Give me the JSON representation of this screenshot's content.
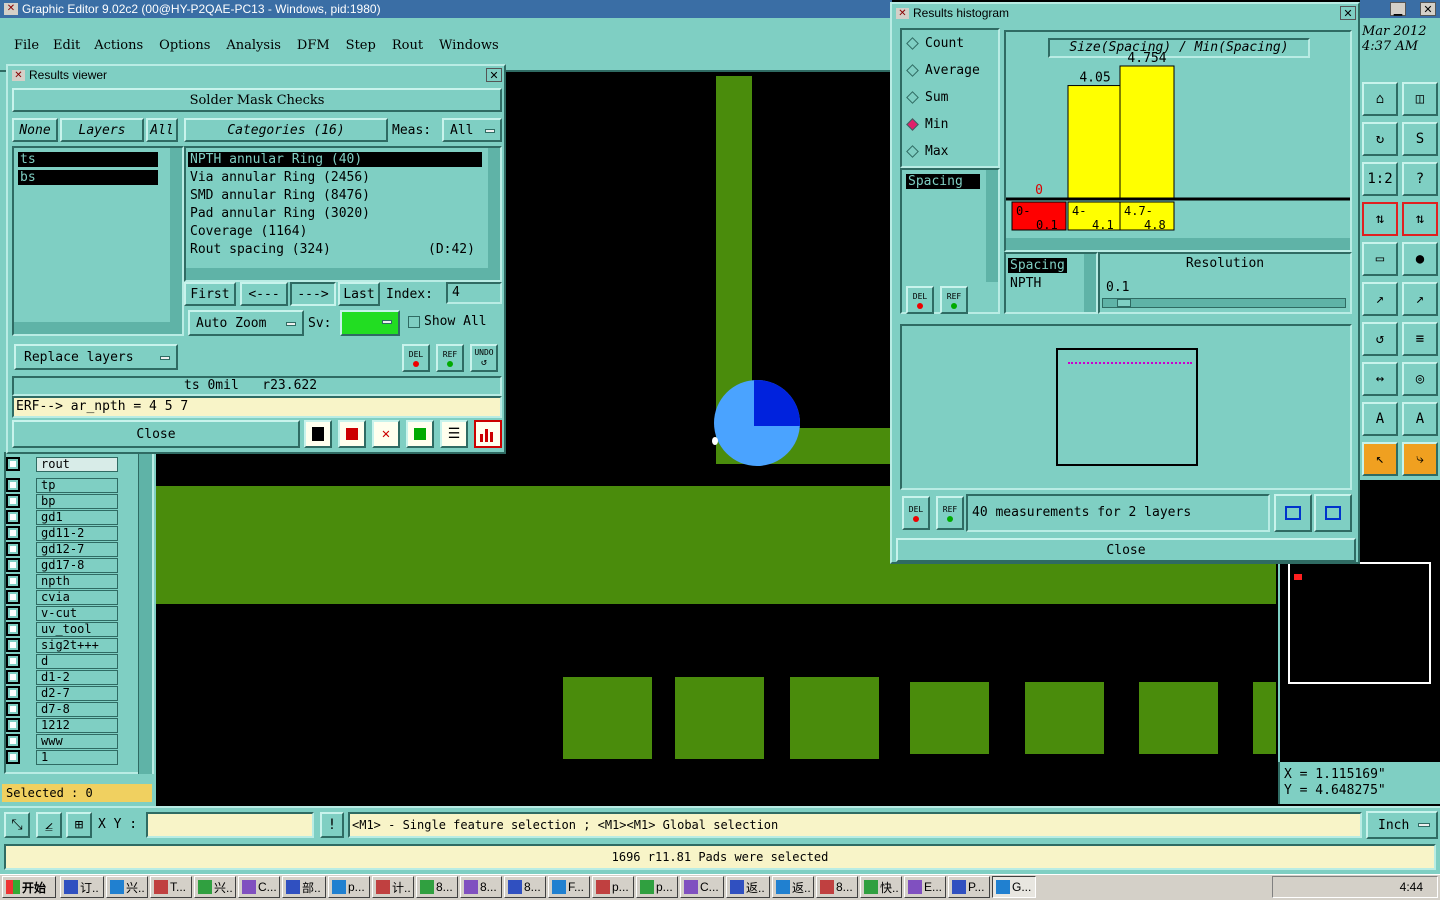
{
  "main_window": {
    "title": "Graphic Editor 9.02c2 (00@HY-P2QAE-PC13 - Windows, pid:1980)"
  },
  "menu": [
    "File",
    "Edit",
    "Actions",
    "Options",
    "Analysis",
    "DFM",
    "Step",
    "Rout",
    "Windows"
  ],
  "clock": {
    "line1": "Mar 2012",
    "line2": "4:37 AM"
  },
  "results_viewer": {
    "title": "Results viewer",
    "header": "Solder Mask Checks",
    "none_label": "None",
    "layers_label": "Layers",
    "all_label": "All",
    "categories_label": "Categories (16)",
    "meas_label": "Meas:",
    "meas_value": "All",
    "layers": [
      "ts",
      "bs"
    ],
    "categories": [
      "NPTH annular Ring (40)",
      "Via annular Ring (2456)",
      "SMD annular Ring (8476)",
      "Pad annular Ring (3020)",
      "Coverage (1164)",
      "Rout spacing (324)"
    ],
    "rout_extra": "(D:42)",
    "first_label": "First",
    "prev_label": "<---",
    "next_label": "--->",
    "last_label": "Last",
    "index_label": "Index:",
    "index_value": "4",
    "auto_zoom_label": "Auto Zoom",
    "sv_label": "Sv:",
    "show_all_label": "Show All",
    "replace_layers_label": "Replace layers",
    "del_label": "DEL",
    "ref_label": "REF",
    "undo_label": "UNDO",
    "status_line": "ts 0mil   r23.622",
    "erf_line": "ERF--> ar_npth = 4 5 7",
    "close_label": "Close"
  },
  "layer_list": {
    "rout": "rout",
    "items": [
      "tp",
      "bp",
      "gd1",
      "gd11-2",
      "gd12-7",
      "gd17-8",
      "npth",
      "cvia",
      "v-cut",
      "uv_tool",
      "sig2t+++",
      "d",
      "d1-2",
      "d2-7",
      "d7-8",
      "1212",
      "www",
      "1"
    ]
  },
  "selected_count": "Selected : 0",
  "histogram": {
    "title": "Results histogram",
    "modes": [
      "Count",
      "Average",
      "Sum",
      "Min",
      "Max"
    ],
    "active_mode": "Min",
    "chart_title": "Size(Spacing) / Min(Spacing)",
    "field_label": "Spacing",
    "field_sel": "Spacing",
    "field_sub": "NPTH",
    "resolution_label": "Resolution",
    "resolution_value": "0.1",
    "measurements": "40 measurements for 2 layers",
    "close_label": "Close",
    "del_label": "DEL",
    "ref_label": "REF"
  },
  "chart_data": {
    "type": "bar",
    "title": "Size(Spacing) / Min(Spacing)",
    "categories": [
      "0-0.1",
      "4-4.1",
      "4.7-4.8"
    ],
    "category_labels": [
      [
        "0-",
        "0.1"
      ],
      [
        "4-",
        "4.1"
      ],
      [
        "4.7-",
        "4.8"
      ]
    ],
    "values": [
      0,
      4.05,
      4.754
    ],
    "value_labels": [
      "0",
      "4.05",
      "4.754"
    ],
    "bar_colors": [
      "#ff0000",
      "#ffff00",
      "#ffff00"
    ]
  },
  "coords": {
    "x": "X = 1.115169\"",
    "y": "Y = 4.648275\""
  },
  "command_bar": {
    "xy_label": "X Y :",
    "xy_value": "",
    "hint": "<M1> - Single feature selection ; <M1><M1> Global selection",
    "unit": "Inch"
  },
  "status_bar": "1696 r11.81 Pads were selected",
  "taskbar": {
    "start": "开始",
    "items": [
      "订..",
      "兴..",
      "T...",
      "兴..",
      "C...",
      "部..",
      "p...",
      "计..",
      "8...",
      "8...",
      "8...",
      "F...",
      "p...",
      "p...",
      "C...",
      "返..",
      "返..",
      "8...",
      "快..",
      "E...",
      "P...",
      "G..."
    ],
    "time": "4:44"
  }
}
